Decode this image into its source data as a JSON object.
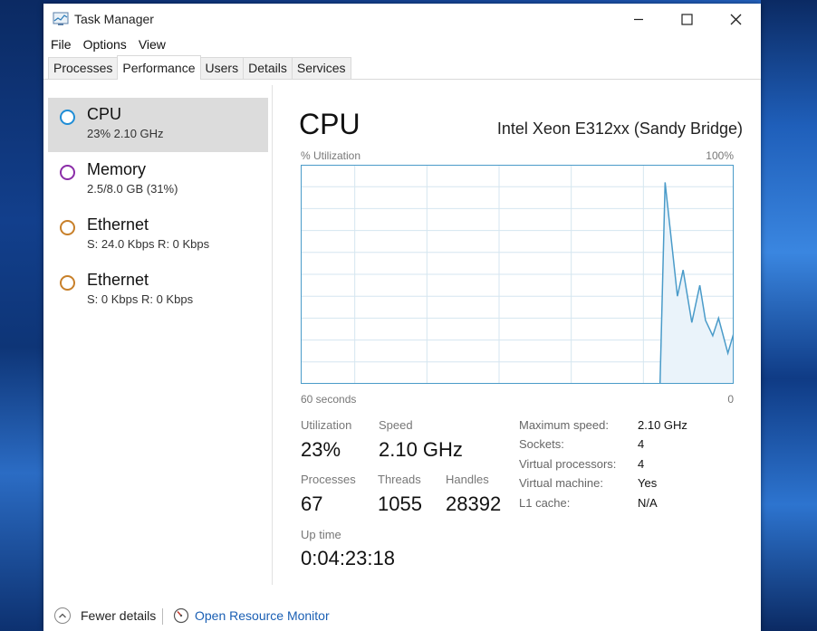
{
  "window": {
    "title": "Task Manager"
  },
  "menu": [
    "File",
    "Options",
    "View"
  ],
  "tabs": [
    {
      "label": "Processes",
      "active": false
    },
    {
      "label": "Performance",
      "active": true
    },
    {
      "label": "Users",
      "active": false
    },
    {
      "label": "Details",
      "active": false
    },
    {
      "label": "Services",
      "active": false
    }
  ],
  "sidebar": {
    "items": [
      {
        "name": "CPU",
        "detail": "23% 2.10 GHz",
        "color": "#1f8dd6",
        "selected": true
      },
      {
        "name": "Memory",
        "detail": "2.5/8.0 GB (31%)",
        "color": "#8b2da8",
        "selected": false
      },
      {
        "name": "Ethernet",
        "detail": "S: 24.0 Kbps R: 0 Kbps",
        "color": "#c8802a",
        "selected": false
      },
      {
        "name": "Ethernet",
        "detail": "S: 0 Kbps R: 0 Kbps",
        "color": "#c8802a",
        "selected": false
      }
    ]
  },
  "main": {
    "title": "CPU",
    "model": "Intel Xeon E312xx (Sandy Bridge)",
    "y_label": "% Utilization",
    "y_max_label": "100%",
    "x_left_label": "60 seconds",
    "x_right_label": "0",
    "stats": {
      "utilization_label": "Utilization",
      "utilization": "23%",
      "speed_label": "Speed",
      "speed": "2.10 GHz",
      "processes_label": "Processes",
      "processes": "67",
      "threads_label": "Threads",
      "threads": "1055",
      "handles_label": "Handles",
      "handles": "28392",
      "uptime_label": "Up time",
      "uptime": "0:04:23:18"
    },
    "specs": [
      {
        "label": "Maximum speed:",
        "value": "2.10 GHz"
      },
      {
        "label": "Sockets:",
        "value": "4"
      },
      {
        "label": "Virtual processors:",
        "value": "4"
      },
      {
        "label": "Virtual machine:",
        "value": "Yes"
      },
      {
        "label": "L1 cache:",
        "value": "N/A"
      }
    ]
  },
  "cpu_history": {
    "seconds": [
      60,
      10.2,
      9.5,
      7.8,
      7,
      5.8,
      4.7,
      3.9,
      2.9,
      2.1,
      0.8,
      0
    ],
    "percent": [
      0,
      0,
      92,
      40,
      52,
      28,
      45,
      29,
      22,
      30,
      14,
      23
    ]
  },
  "footer": {
    "fewer_details": "Fewer details",
    "resource_monitor": "Open Resource Monitor"
  },
  "colors": {
    "accent": "#1f8dd6",
    "graph_line": "#4a9bc9",
    "graph_fill": "#eaf3fa",
    "grid": "#d5e6f0"
  }
}
